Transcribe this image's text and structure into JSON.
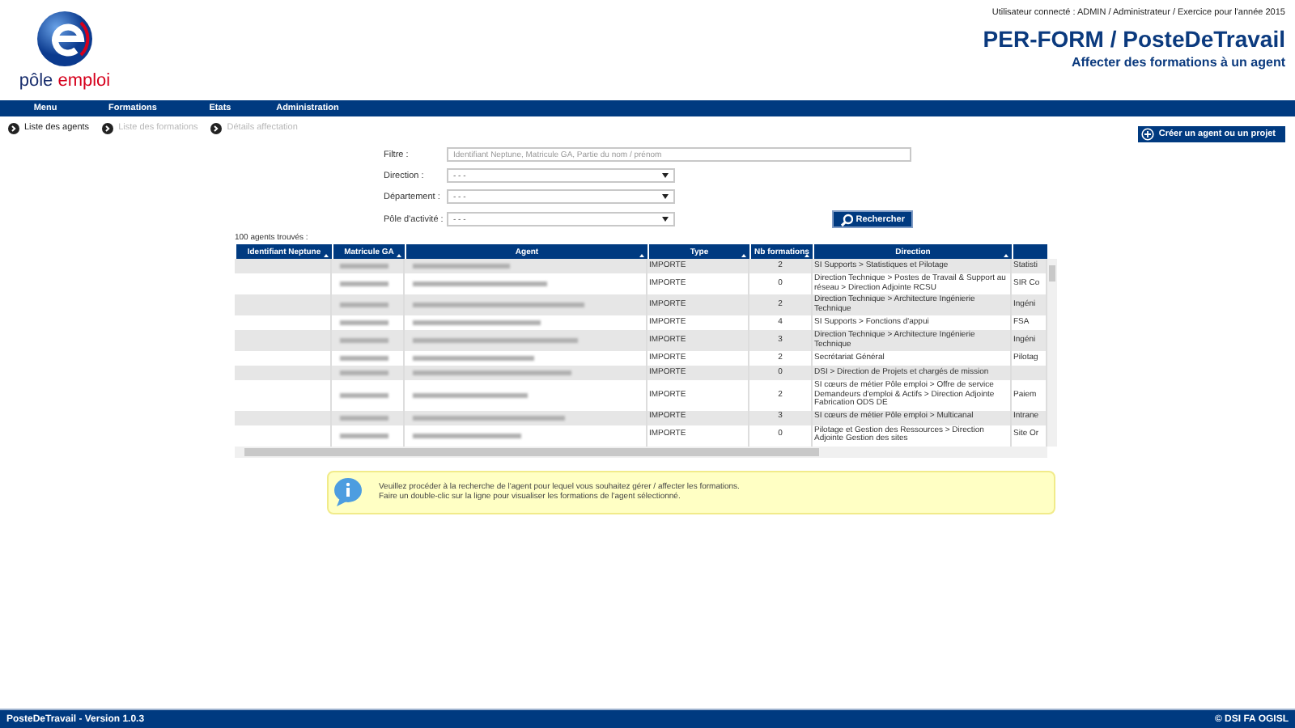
{
  "header": {
    "user_line": "Utilisateur connecté : ADMIN / Administrateur / Exercice pour l'année 2015",
    "title": "PER-FORM / PosteDeTravail",
    "subtitle": "Affecter des formations à un agent",
    "logo_words": [
      "pôle",
      "emploi"
    ]
  },
  "menu": [
    "Menu",
    "Formations",
    "Etats",
    "Administration"
  ],
  "breadcrumb": [
    {
      "label": "Liste des agents",
      "active": true
    },
    {
      "label": "Liste des formations",
      "active": false
    },
    {
      "label": "Détails affectation",
      "active": false
    }
  ],
  "create_button": "Créer un agent ou un projet",
  "filters": {
    "filter_label": "Filtre :",
    "filter_placeholder": "Identifiant Neptune, Matricule GA, Partie du nom / prénom",
    "selects": [
      {
        "label": "Direction :",
        "value": "- - -"
      },
      {
        "label": "Département :",
        "value": "- - -"
      },
      {
        "label": "Pôle d'activité :",
        "value": "- - -"
      }
    ],
    "search_button": "Rechercher"
  },
  "result_count": "100 agents trouvés :",
  "table": {
    "columns": [
      "Identifiant Neptune",
      "Matricule GA",
      "Agent",
      "Type",
      "Nb formations",
      "Direction"
    ],
    "rows": [
      {
        "type": "IMPORTE",
        "nb_formations": "2",
        "direction": "SI Supports > Statistiques et Pilotage",
        "column_7": "Statisti"
      },
      {
        "type": "IMPORTE",
        "nb_formations": "0",
        "direction": "Direction Technique > Postes de Travail & Support au réseau > Direction Adjointe RCSU",
        "column_7": "SIR Co"
      },
      {
        "type": "IMPORTE",
        "nb_formations": "2",
        "direction": "Direction Technique > Architecture Ingénierie Technique",
        "column_7": "Ingéni"
      },
      {
        "type": "IMPORTE",
        "nb_formations": "4",
        "direction": "SI Supports > Fonctions d'appui",
        "column_7": "FSA"
      },
      {
        "type": "IMPORTE",
        "nb_formations": "3",
        "direction": "Direction Technique > Architecture Ingénierie Technique",
        "column_7": "Ingéni"
      },
      {
        "type": "IMPORTE",
        "nb_formations": "2",
        "direction": "Secrétariat Général",
        "column_7": "Pilotag"
      },
      {
        "type": "IMPORTE",
        "nb_formations": "0",
        "direction": "DSI > Direction de Projets et chargés de mission"
      },
      {
        "type": "IMPORTE",
        "nb_formations": "2",
        "direction": "SI cœurs de métier Pôle emploi > Offre de service Demandeurs d'emploi & Actifs > Direction Adjointe Fabrication ODS DE",
        "column_7": "Paiem"
      },
      {
        "type": "IMPORTE",
        "nb_formations": "3",
        "direction": "SI cœurs de métier Pôle emploi > Multicanal",
        "column_7": "Intrane"
      },
      {
        "type": "IMPORTE",
        "nb_formations": "0",
        "direction": "Pilotage et Gestion des Ressources > Direction Adjointe Gestion des sites",
        "column_7": "Site Or"
      }
    ]
  },
  "info": [
    "Veuillez procéder à la recherche de l'agent pour lequel vous souhaitez gérer / affecter les formations.",
    "Faire un double-clic sur la ligne pour visualiser les formations de l'agent sélectionné."
  ],
  "footer": {
    "left": "PosteDeTravail - Version 1.0.3",
    "right": "© DSI FA OGISL"
  }
}
